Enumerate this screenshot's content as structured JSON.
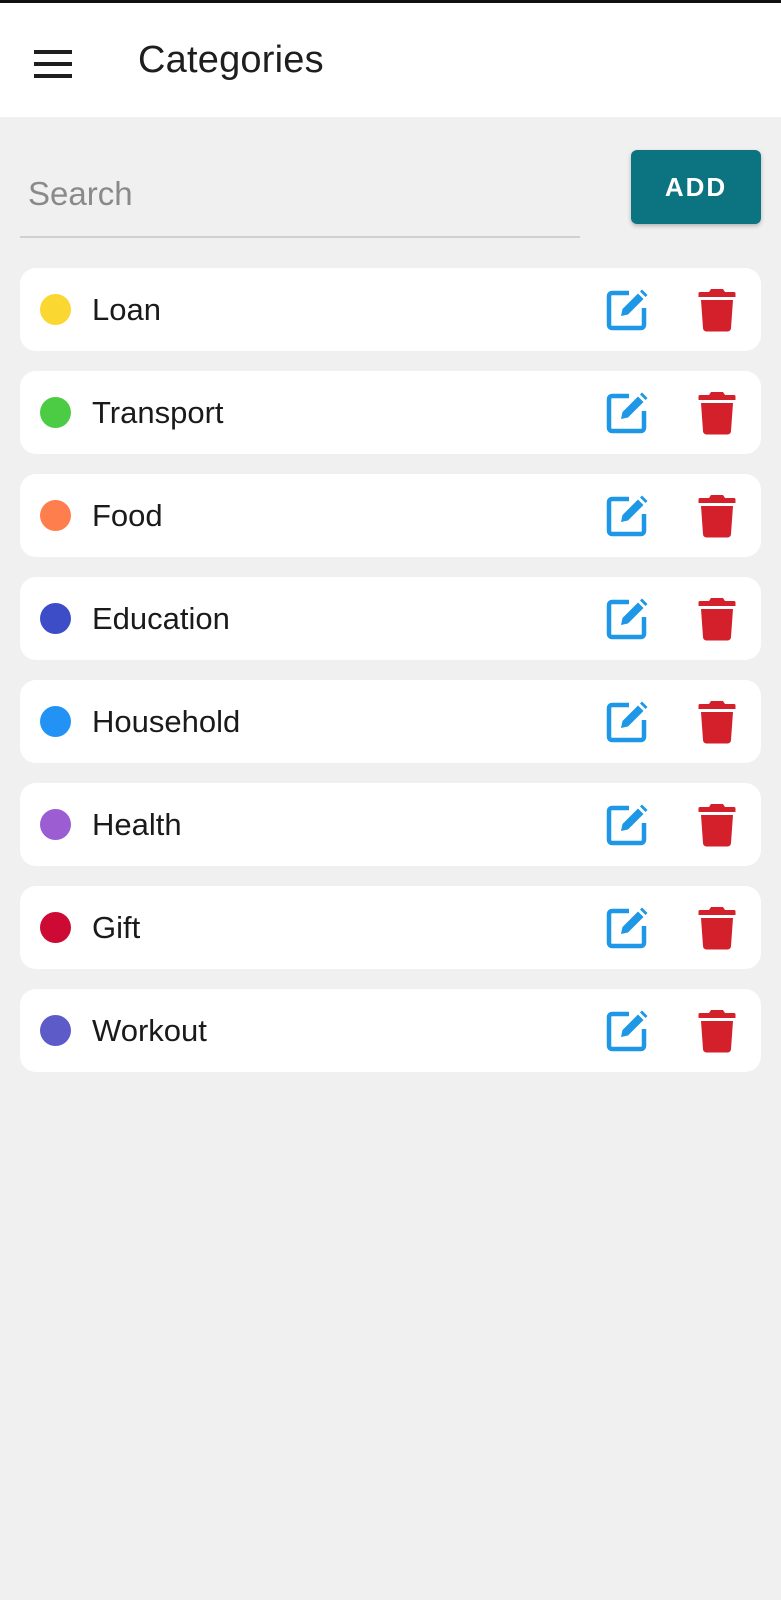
{
  "header": {
    "title": "Categories",
    "menu_icon": "hamburger-menu-icon"
  },
  "search": {
    "placeholder": "Search",
    "value": ""
  },
  "add_button": {
    "label": "ADD"
  },
  "colors": {
    "accent": "#0b7480",
    "edit_icon": "#1e97e6",
    "delete_icon": "#d4202a",
    "background": "#f0f0f0"
  },
  "categories": [
    {
      "label": "Loan",
      "color": "#fbd732"
    },
    {
      "label": "Transport",
      "color": "#4ccb45"
    },
    {
      "label": "Food",
      "color": "#ff7e4d"
    },
    {
      "label": "Education",
      "color": "#3d4dc8"
    },
    {
      "label": "Household",
      "color": "#2293f5"
    },
    {
      "label": "Health",
      "color": "#9c5cd2"
    },
    {
      "label": "Gift",
      "color": "#cc0a33"
    },
    {
      "label": "Workout",
      "color": "#5c5bc8"
    }
  ]
}
